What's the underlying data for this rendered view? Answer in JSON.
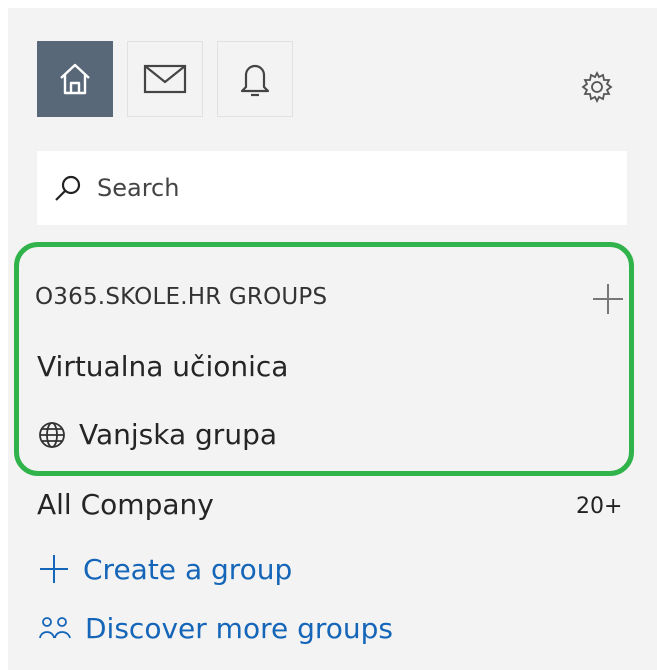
{
  "topbar": {
    "icons": [
      "home-icon",
      "mail-icon",
      "bell-icon",
      "gear-icon"
    ]
  },
  "search": {
    "placeholder": "Search"
  },
  "groups_section": {
    "title": "O365.SKOLE.HR GROUPS",
    "items": [
      {
        "label": "Virtualna učionica"
      },
      {
        "label": "Vanjska grupa",
        "icon": "globe-icon"
      }
    ]
  },
  "all_company": {
    "label": "All Company",
    "count": "20+"
  },
  "actions": {
    "create": "Create a group",
    "discover": "Discover more groups"
  },
  "colors": {
    "active_nav": "#586878",
    "highlight_border": "#2fb34a",
    "link": "#1565b8",
    "panel_bg": "#f3f3f3"
  }
}
